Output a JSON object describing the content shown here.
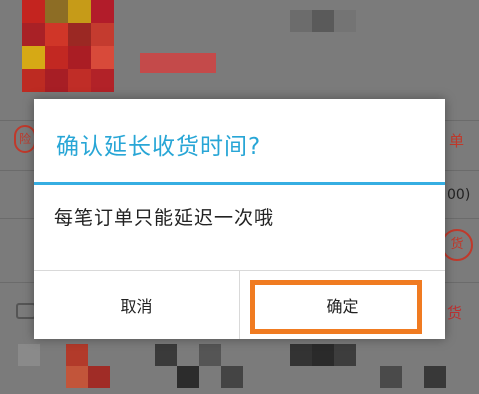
{
  "background": {
    "right_labels": [
      "单",
      "00)",
      "货",
      "货"
    ],
    "badge_text": "险",
    "pill_text": "货"
  },
  "dialog": {
    "title": "确认延长收货时间?",
    "message": "每笔订单只能延迟一次哦",
    "cancel_label": "取消",
    "confirm_label": "确定"
  },
  "colors": {
    "title": "#28a6d6",
    "divider": "#36aee2",
    "highlight": "#f07b21",
    "overlay": "#7b7b7b"
  }
}
